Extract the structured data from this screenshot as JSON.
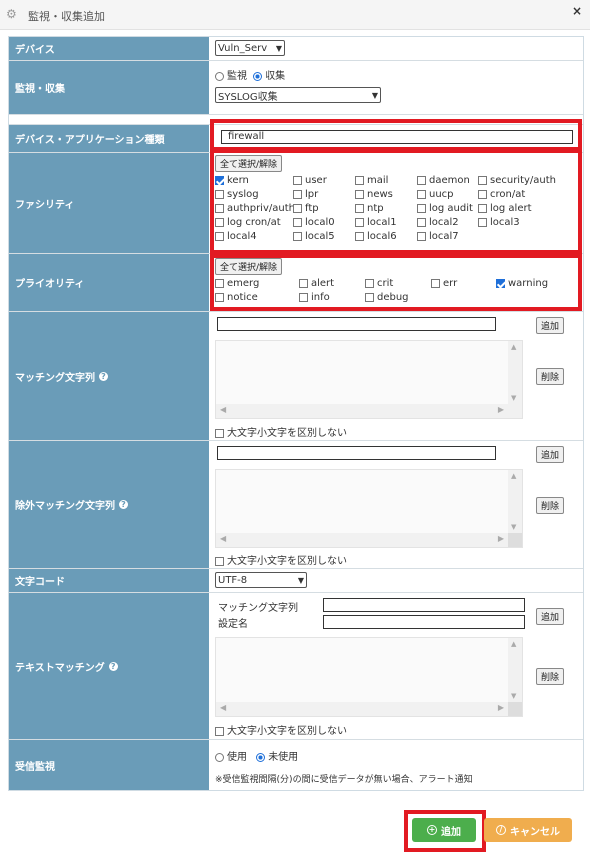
{
  "window": {
    "title": "監視・収集追加",
    "icon": "gear-icon",
    "close_label": "×"
  },
  "device": {
    "label": "デバイス",
    "selected": "Vuln_Serv"
  },
  "mode": {
    "label": "監視・収集",
    "options": [
      {
        "label": "監視",
        "checked": false
      },
      {
        "label": "収集",
        "checked": true
      }
    ],
    "select_value": "SYSLOG収集"
  },
  "app_type": {
    "label": "デバイス・アプリケーション種類",
    "value": "firewall"
  },
  "facility": {
    "label": "ファシリティ",
    "select_all": "全て選択/解除",
    "items": [
      {
        "label": "kern",
        "checked": true
      },
      {
        "label": "user",
        "checked": false
      },
      {
        "label": "mail",
        "checked": false
      },
      {
        "label": "daemon",
        "checked": false
      },
      {
        "label": "security/auth",
        "checked": false
      },
      {
        "label": "syslog",
        "checked": false
      },
      {
        "label": "lpr",
        "checked": false
      },
      {
        "label": "news",
        "checked": false
      },
      {
        "label": "uucp",
        "checked": false
      },
      {
        "label": "cron/at",
        "checked": false
      },
      {
        "label": "authpriv/auth",
        "checked": false
      },
      {
        "label": "ftp",
        "checked": false
      },
      {
        "label": "ntp",
        "checked": false
      },
      {
        "label": "log audit",
        "checked": false
      },
      {
        "label": "log alert",
        "checked": false
      },
      {
        "label": "log cron/at",
        "checked": false
      },
      {
        "label": "local0",
        "checked": false
      },
      {
        "label": "local1",
        "checked": false
      },
      {
        "label": "local2",
        "checked": false
      },
      {
        "label": "local3",
        "checked": false
      },
      {
        "label": "local4",
        "checked": false
      },
      {
        "label": "local5",
        "checked": false
      },
      {
        "label": "local6",
        "checked": false
      },
      {
        "label": "local7",
        "checked": false
      }
    ]
  },
  "priority": {
    "label": "プライオリティ",
    "select_all": "全て選択/解除",
    "items": [
      {
        "label": "emerg",
        "checked": false
      },
      {
        "label": "alert",
        "checked": false
      },
      {
        "label": "crit",
        "checked": false
      },
      {
        "label": "err",
        "checked": false
      },
      {
        "label": "warning",
        "checked": true
      },
      {
        "label": "notice",
        "checked": false
      },
      {
        "label": "info",
        "checked": false
      },
      {
        "label": "debug",
        "checked": false
      }
    ]
  },
  "matching": {
    "label": "マッチング文字列",
    "add": "追加",
    "delete": "削除",
    "case_label": "大文字小文字を区別しない"
  },
  "exclude": {
    "label": "除外マッチング文字列",
    "add": "追加",
    "delete": "削除",
    "case_label": "大文字小文字を区別しない"
  },
  "charset": {
    "label": "文字コード",
    "selected": "UTF-8"
  },
  "text_matching": {
    "label": "テキストマッチング",
    "field1_label": "マッチング文字列",
    "field2_label": "設定名",
    "add": "追加",
    "delete": "削除",
    "case_label": "大文字小文字を区別しない"
  },
  "recv_monitor": {
    "label": "受信監視",
    "options": [
      {
        "label": "使用",
        "checked": false
      },
      {
        "label": "未使用",
        "checked": true
      }
    ],
    "note": "※受信監視間隔(分)の間に受信データが無い場合、アラート通知"
  },
  "footer": {
    "add": "追加",
    "cancel": "キャンセル"
  },
  "colors": {
    "label_bg": "#6a9cb8",
    "highlight": "#e21a22",
    "add_btn": "#4cae4c",
    "cancel_btn": "#f0ad4e",
    "check": "#1e6fd9"
  }
}
